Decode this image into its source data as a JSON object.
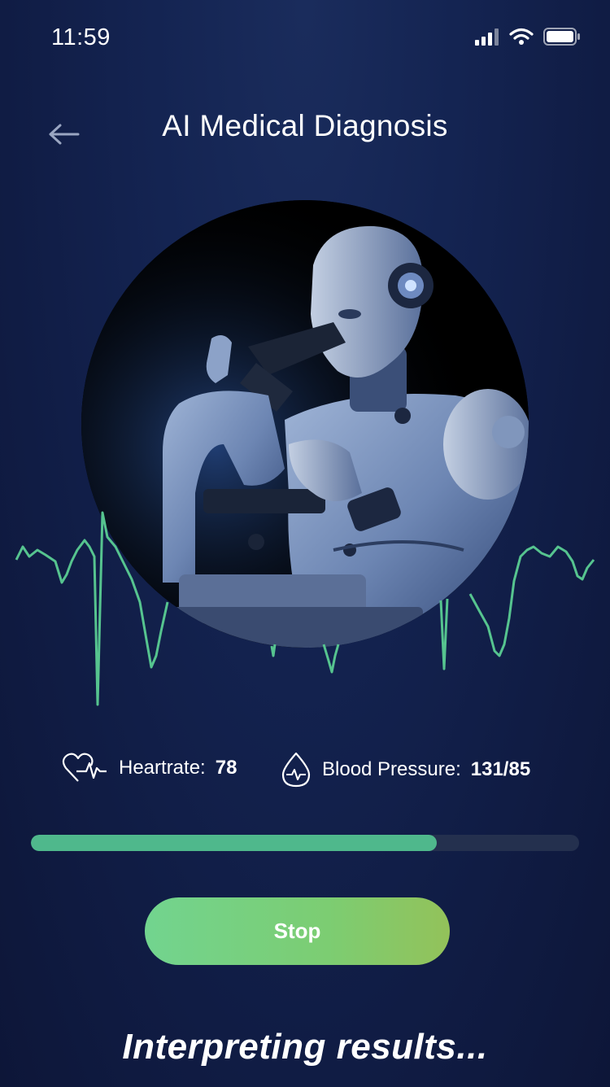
{
  "status_bar": {
    "time": "11:59"
  },
  "header": {
    "title": "AI Medical Diagnosis",
    "back_icon": "arrow-left-icon"
  },
  "hero": {
    "image": "robot-with-microscope"
  },
  "vitals": {
    "heartrate": {
      "label": "Heartrate:",
      "value": "78",
      "icon": "heart-pulse-icon"
    },
    "blood_pressure": {
      "label": "Blood Pressure:",
      "value": "131/85",
      "icon": "blood-drop-pulse-icon"
    }
  },
  "progress": {
    "fraction": 0.74
  },
  "actions": {
    "stop_label": "Stop"
  },
  "footer": {
    "status_text": "Interpreting results..."
  },
  "colors": {
    "accent": "#4fb88c",
    "ecg": "#56c48f",
    "button_start": "#72d48f",
    "button_end": "#93c25a"
  }
}
